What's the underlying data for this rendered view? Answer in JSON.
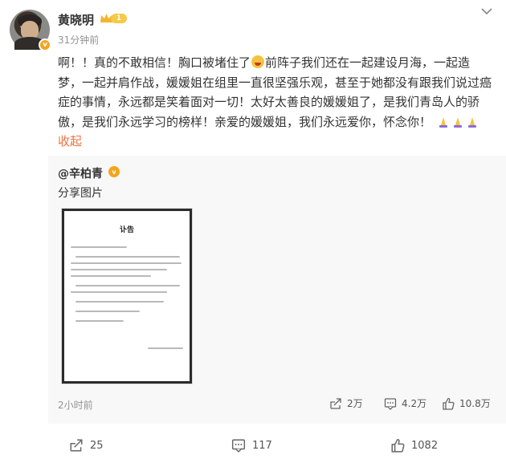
{
  "post": {
    "author": "黄晓明",
    "level": "1",
    "time": "31分钟前",
    "text_part1": "啊！！真的不敢相信！胸口被堵住了",
    "text_part2": "前阵子我们还在一起建设月海，一起造梦，一起并肩作战，媛媛姐在组里一直很坚强乐观，甚至于她都没有跟我们说过癌症的事情，永远都是笑着面对一切！太好太善良的媛媛姐了，是我们青岛人的骄傲，是我们永远学习的榜样！亲爱的媛媛姐，我们永远爱你，怀念你！",
    "collapse_label": "收起"
  },
  "repost": {
    "author": "@辛柏青",
    "text": "分享图片",
    "image_title": "讣告",
    "time": "2小时前",
    "shares": "2万",
    "comments": "4.2万",
    "likes": "10.8万"
  },
  "actions": {
    "shares": "25",
    "comments": "117",
    "likes": "1082"
  },
  "icons": [
    "verified-icon",
    "crown-icon",
    "chevron-down-icon",
    "crying-emoji-icon",
    "pray-emoji-icon",
    "share-icon",
    "comment-icon",
    "like-icon"
  ],
  "colors": {
    "accent": "#eb7340",
    "verified": "#f4a51c",
    "muted": "#939393"
  }
}
